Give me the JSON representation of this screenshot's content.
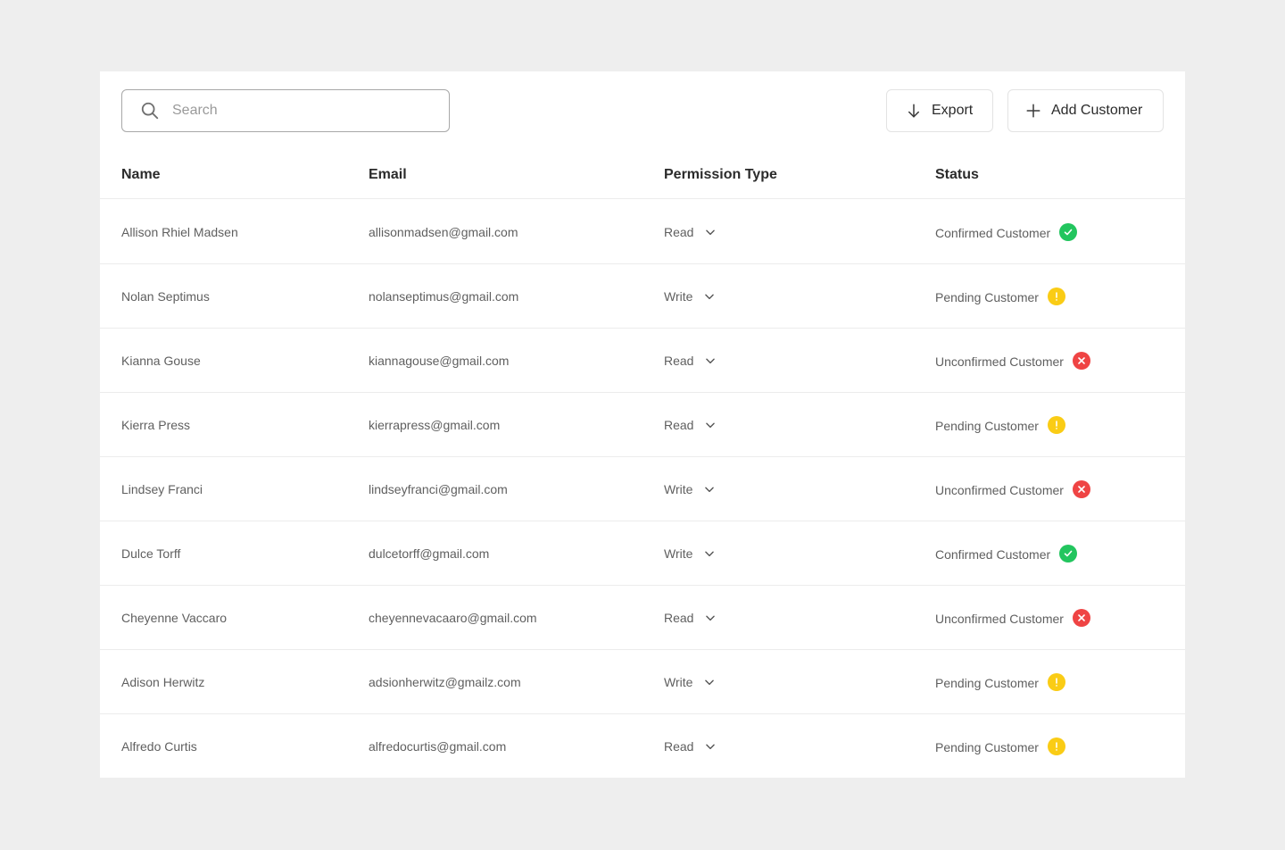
{
  "toolbar": {
    "search_placeholder": "Search",
    "export_label": "Export",
    "add_label": "Add Customer"
  },
  "table": {
    "headers": {
      "name": "Name",
      "email": "Email",
      "permission": "Permission Type",
      "status": "Status"
    },
    "rows": [
      {
        "name": "Allison Rhiel Madsen",
        "email": "allisonmadsen@gmail.com",
        "permission": "Read",
        "status": "Confirmed Customer",
        "status_type": "confirmed"
      },
      {
        "name": "Nolan Septimus",
        "email": "nolanseptimus@gmail.com",
        "permission": "Write",
        "status": "Pending Customer",
        "status_type": "pending"
      },
      {
        "name": "Kianna Gouse",
        "email": "kiannagouse@gmail.com",
        "permission": "Read",
        "status": "Unconfirmed Customer",
        "status_type": "unconfirmed"
      },
      {
        "name": "Kierra Press",
        "email": "kierrapress@gmail.com",
        "permission": "Read",
        "status": "Pending Customer",
        "status_type": "pending"
      },
      {
        "name": "Lindsey Franci",
        "email": "lindseyfranci@gmail.com",
        "permission": "Write",
        "status": "Unconfirmed Customer",
        "status_type": "unconfirmed"
      },
      {
        "name": "Dulce Torff",
        "email": "dulcetorff@gmail.com",
        "permission": "Write",
        "status": "Confirmed Customer",
        "status_type": "confirmed"
      },
      {
        "name": "Cheyenne Vaccaro",
        "email": "cheyennevacaaro@gmail.com",
        "permission": "Read",
        "status": "Unconfirmed Customer",
        "status_type": "unconfirmed"
      },
      {
        "name": "Adison Herwitz",
        "email": "adsionherwitz@gmailz.com",
        "permission": "Write",
        "status": "Pending Customer",
        "status_type": "pending"
      },
      {
        "name": "Alfredo Curtis",
        "email": "alfredocurtis@gmail.com",
        "permission": "Read",
        "status": "Pending Customer",
        "status_type": "pending"
      }
    ]
  },
  "colors": {
    "confirmed": "#22c55e",
    "pending": "#facc15",
    "unconfirmed": "#ef4444",
    "page_bg": "#eeeeee"
  },
  "icons": {
    "search": "search-icon",
    "export": "arrow-down-icon",
    "add": "plus-icon",
    "dropdown": "chevron-down-icon",
    "confirmed": "check-circle-icon",
    "pending": "exclamation-circle-icon",
    "unconfirmed": "x-circle-icon"
  }
}
